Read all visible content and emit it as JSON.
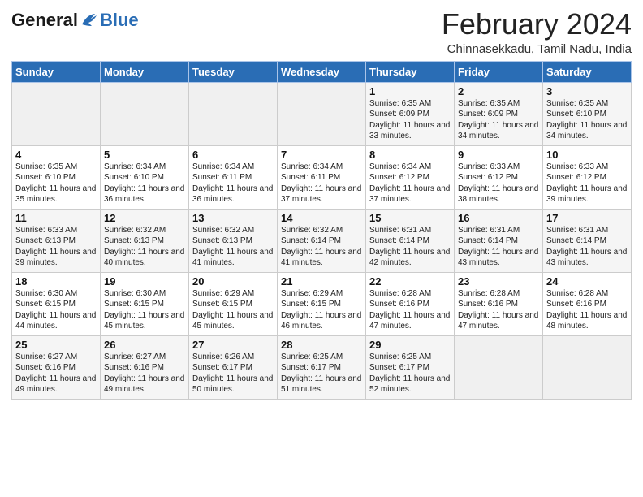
{
  "header": {
    "logo_general": "General",
    "logo_blue": "Blue",
    "month_title": "February 2024",
    "location": "Chinnasekkadu, Tamil Nadu, India"
  },
  "days_of_week": [
    "Sunday",
    "Monday",
    "Tuesday",
    "Wednesday",
    "Thursday",
    "Friday",
    "Saturday"
  ],
  "weeks": [
    [
      {
        "day": "",
        "info": ""
      },
      {
        "day": "",
        "info": ""
      },
      {
        "day": "",
        "info": ""
      },
      {
        "day": "",
        "info": ""
      },
      {
        "day": "1",
        "info": "Sunrise: 6:35 AM\nSunset: 6:09 PM\nDaylight: 11 hours\nand 33 minutes."
      },
      {
        "day": "2",
        "info": "Sunrise: 6:35 AM\nSunset: 6:09 PM\nDaylight: 11 hours\nand 34 minutes."
      },
      {
        "day": "3",
        "info": "Sunrise: 6:35 AM\nSunset: 6:10 PM\nDaylight: 11 hours\nand 34 minutes."
      }
    ],
    [
      {
        "day": "4",
        "info": "Sunrise: 6:35 AM\nSunset: 6:10 PM\nDaylight: 11 hours\nand 35 minutes."
      },
      {
        "day": "5",
        "info": "Sunrise: 6:34 AM\nSunset: 6:10 PM\nDaylight: 11 hours\nand 36 minutes."
      },
      {
        "day": "6",
        "info": "Sunrise: 6:34 AM\nSunset: 6:11 PM\nDaylight: 11 hours\nand 36 minutes."
      },
      {
        "day": "7",
        "info": "Sunrise: 6:34 AM\nSunset: 6:11 PM\nDaylight: 11 hours\nand 37 minutes."
      },
      {
        "day": "8",
        "info": "Sunrise: 6:34 AM\nSunset: 6:12 PM\nDaylight: 11 hours\nand 37 minutes."
      },
      {
        "day": "9",
        "info": "Sunrise: 6:33 AM\nSunset: 6:12 PM\nDaylight: 11 hours\nand 38 minutes."
      },
      {
        "day": "10",
        "info": "Sunrise: 6:33 AM\nSunset: 6:12 PM\nDaylight: 11 hours\nand 39 minutes."
      }
    ],
    [
      {
        "day": "11",
        "info": "Sunrise: 6:33 AM\nSunset: 6:13 PM\nDaylight: 11 hours\nand 39 minutes."
      },
      {
        "day": "12",
        "info": "Sunrise: 6:32 AM\nSunset: 6:13 PM\nDaylight: 11 hours\nand 40 minutes."
      },
      {
        "day": "13",
        "info": "Sunrise: 6:32 AM\nSunset: 6:13 PM\nDaylight: 11 hours\nand 41 minutes."
      },
      {
        "day": "14",
        "info": "Sunrise: 6:32 AM\nSunset: 6:14 PM\nDaylight: 11 hours\nand 41 minutes."
      },
      {
        "day": "15",
        "info": "Sunrise: 6:31 AM\nSunset: 6:14 PM\nDaylight: 11 hours\nand 42 minutes."
      },
      {
        "day": "16",
        "info": "Sunrise: 6:31 AM\nSunset: 6:14 PM\nDaylight: 11 hours\nand 43 minutes."
      },
      {
        "day": "17",
        "info": "Sunrise: 6:31 AM\nSunset: 6:14 PM\nDaylight: 11 hours\nand 43 minutes."
      }
    ],
    [
      {
        "day": "18",
        "info": "Sunrise: 6:30 AM\nSunset: 6:15 PM\nDaylight: 11 hours\nand 44 minutes."
      },
      {
        "day": "19",
        "info": "Sunrise: 6:30 AM\nSunset: 6:15 PM\nDaylight: 11 hours\nand 45 minutes."
      },
      {
        "day": "20",
        "info": "Sunrise: 6:29 AM\nSunset: 6:15 PM\nDaylight: 11 hours\nand 45 minutes."
      },
      {
        "day": "21",
        "info": "Sunrise: 6:29 AM\nSunset: 6:15 PM\nDaylight: 11 hours\nand 46 minutes."
      },
      {
        "day": "22",
        "info": "Sunrise: 6:28 AM\nSunset: 6:16 PM\nDaylight: 11 hours\nand 47 minutes."
      },
      {
        "day": "23",
        "info": "Sunrise: 6:28 AM\nSunset: 6:16 PM\nDaylight: 11 hours\nand 47 minutes."
      },
      {
        "day": "24",
        "info": "Sunrise: 6:28 AM\nSunset: 6:16 PM\nDaylight: 11 hours\nand 48 minutes."
      }
    ],
    [
      {
        "day": "25",
        "info": "Sunrise: 6:27 AM\nSunset: 6:16 PM\nDaylight: 11 hours\nand 49 minutes."
      },
      {
        "day": "26",
        "info": "Sunrise: 6:27 AM\nSunset: 6:16 PM\nDaylight: 11 hours\nand 49 minutes."
      },
      {
        "day": "27",
        "info": "Sunrise: 6:26 AM\nSunset: 6:17 PM\nDaylight: 11 hours\nand 50 minutes."
      },
      {
        "day": "28",
        "info": "Sunrise: 6:25 AM\nSunset: 6:17 PM\nDaylight: 11 hours\nand 51 minutes."
      },
      {
        "day": "29",
        "info": "Sunrise: 6:25 AM\nSunset: 6:17 PM\nDaylight: 11 hours\nand 52 minutes."
      },
      {
        "day": "",
        "info": ""
      },
      {
        "day": "",
        "info": ""
      }
    ]
  ]
}
